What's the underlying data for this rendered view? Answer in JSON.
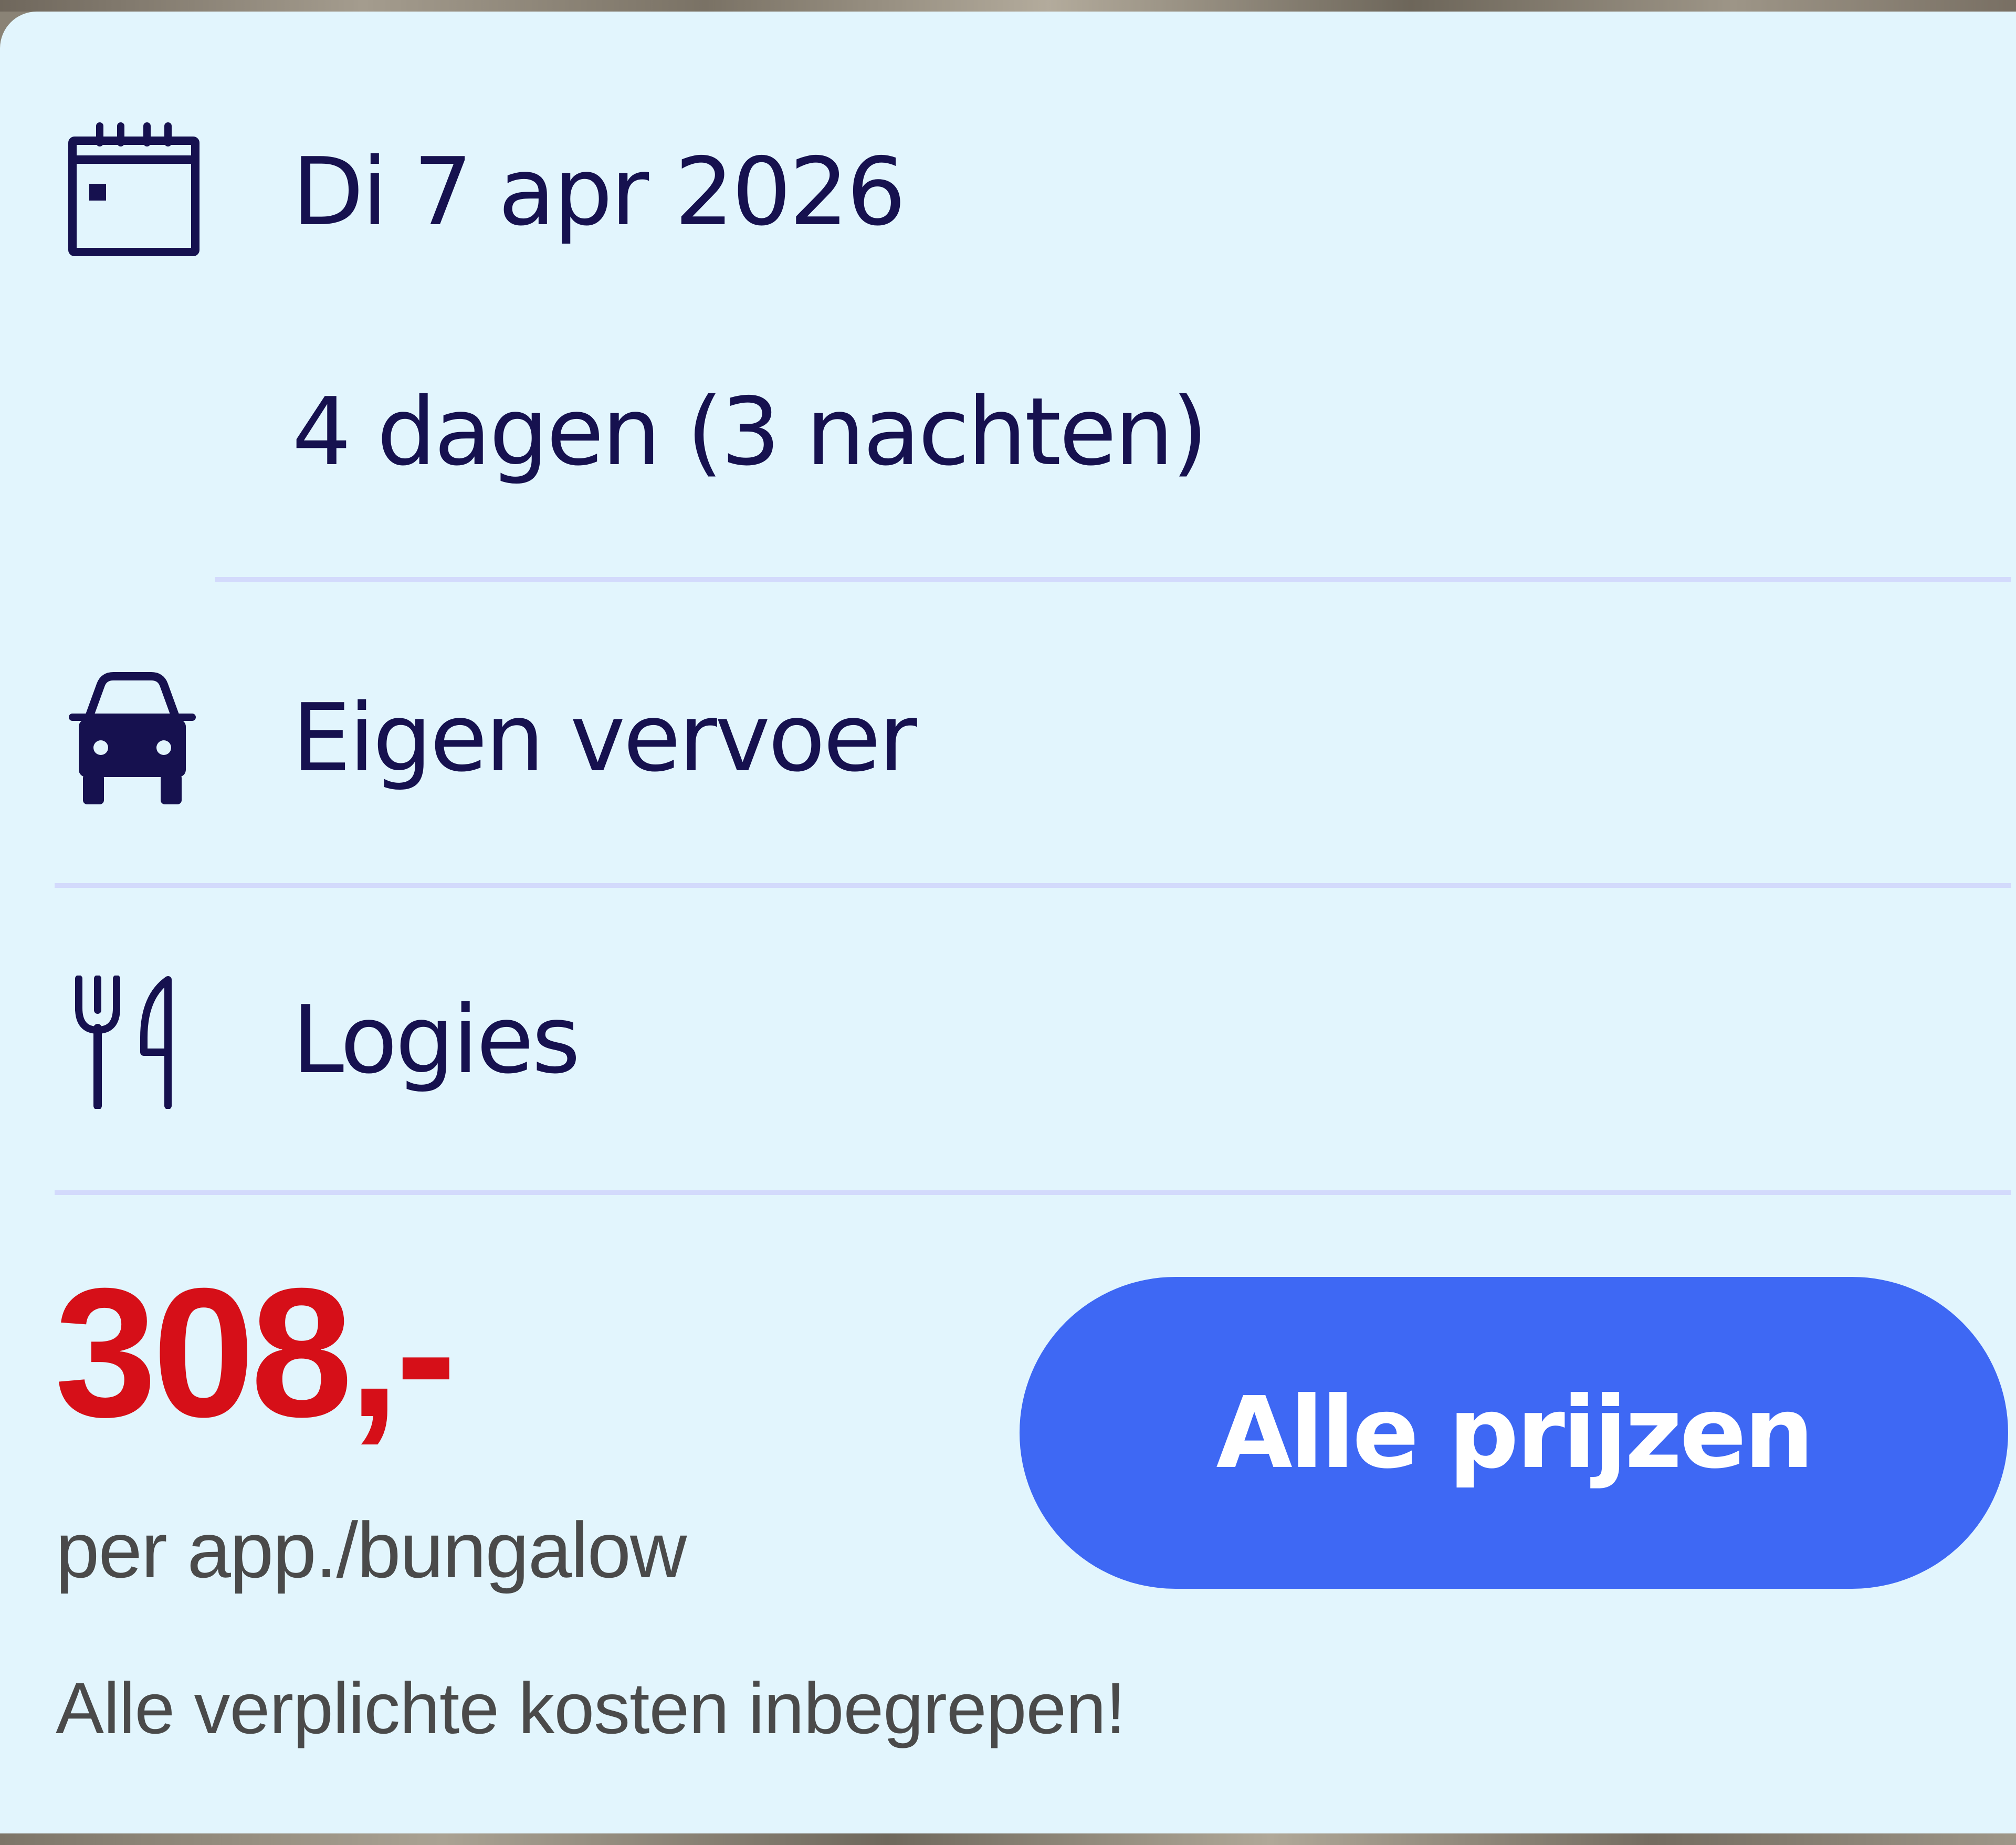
{
  "trip": {
    "date": "Di 7 apr 2026",
    "duration": "4 dagen (3 nachten)",
    "transport": "Eigen vervoer",
    "board": "Logies"
  },
  "price": {
    "amount": "308,-",
    "unit": "per app./bungalow",
    "note": "Alle verplichte kosten inbegrepen!"
  },
  "actions": {
    "all_prices_label": "Alle prijzen"
  },
  "icons": {
    "date": "calendar-icon",
    "transport": "car-icon",
    "board": "cutlery-icon"
  },
  "colors": {
    "card_background": "#e2f5fd",
    "text": "#16114f",
    "price": "#d60f18",
    "button": "#3e68f4",
    "divider": "#d3dafc",
    "muted_text": "#4a4a4a"
  }
}
